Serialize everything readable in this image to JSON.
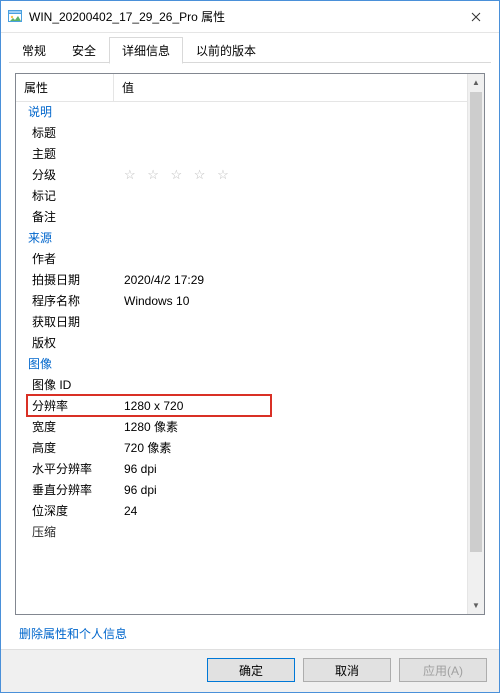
{
  "titlebar": {
    "title": "WIN_20200402_17_29_26_Pro 属性"
  },
  "tabs": {
    "general": "常规",
    "security": "安全",
    "details": "详细信息",
    "previous": "以前的版本"
  },
  "headers": {
    "property": "属性",
    "value": "值"
  },
  "groups": {
    "description": "说明",
    "origin": "来源",
    "image": "图像"
  },
  "rows": {
    "title_label": "标题",
    "subject_label": "主题",
    "rating_label": "分级",
    "rating_value": "☆ ☆ ☆ ☆ ☆",
    "tags_label": "标记",
    "comments_label": "备注",
    "author_label": "作者",
    "date_taken_label": "拍摄日期",
    "date_taken_value": "2020/4/2 17:29",
    "program_label": "程序名称",
    "program_value": "Windows 10",
    "acquired_label": "获取日期",
    "copyright_label": "版权",
    "image_id_label": "图像 ID",
    "dimensions_label": "分辨率",
    "dimensions_value": "1280 x 720",
    "width_label": "宽度",
    "width_value": "1280 像素",
    "height_label": "高度",
    "height_value": "720 像素",
    "hres_label": "水平分辨率",
    "hres_value": "96 dpi",
    "vres_label": "垂直分辨率",
    "vres_value": "96 dpi",
    "bitdepth_label": "位深度",
    "bitdepth_value": "24",
    "compress_label": "压缩"
  },
  "link": {
    "remove": "删除属性和个人信息"
  },
  "buttons": {
    "ok": "确定",
    "cancel": "取消",
    "apply": "应用(A)"
  }
}
